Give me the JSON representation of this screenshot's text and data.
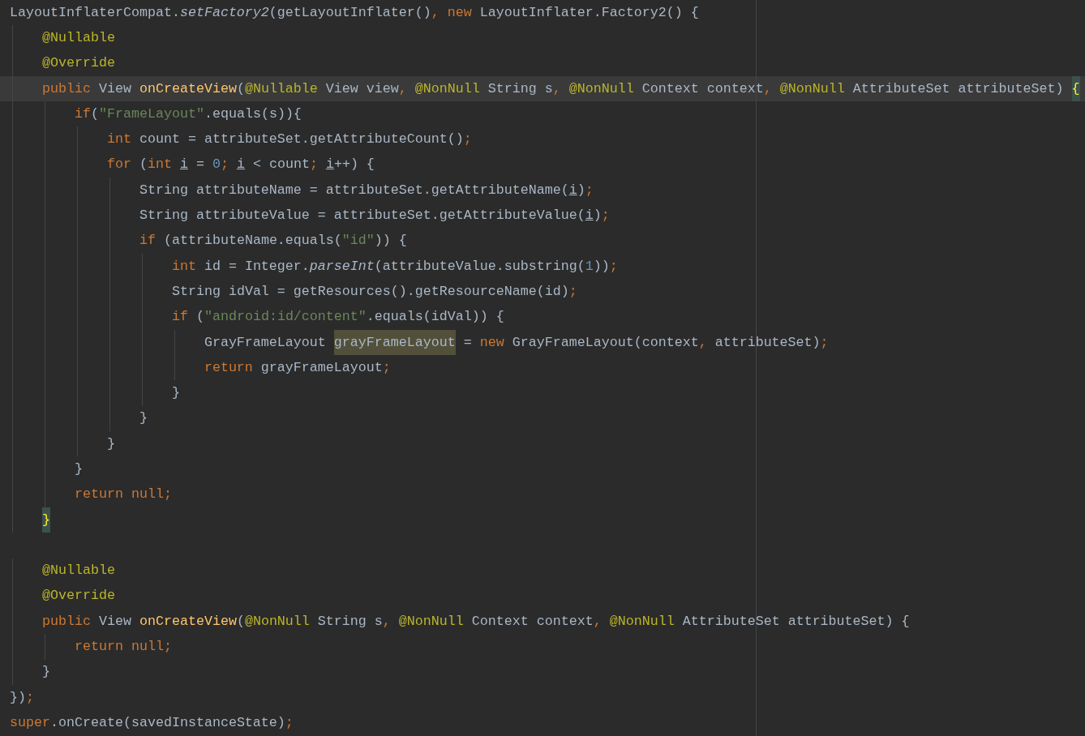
{
  "editor": {
    "lines": [
      {
        "current": false,
        "tokens": [
          {
            "text": "LayoutInflaterCompat.",
            "kind": "plain"
          },
          {
            "text": "setFactory2",
            "kind": "static"
          },
          {
            "text": "(getLayoutInflater()",
            "kind": "plain"
          },
          {
            "text": ", ",
            "kind": "punct"
          },
          {
            "text": "new ",
            "kind": "keyword"
          },
          {
            "text": "LayoutInflater.Factory2() {",
            "kind": "plain"
          }
        ]
      },
      {
        "current": false,
        "tokens": [
          {
            "text": "    @Nullable",
            "kind": "annotation"
          }
        ]
      },
      {
        "current": false,
        "tokens": [
          {
            "text": "    @Override",
            "kind": "annotation"
          }
        ]
      },
      {
        "current": true,
        "tokens": [
          {
            "text": "    public ",
            "kind": "keyword"
          },
          {
            "text": "View ",
            "kind": "plain"
          },
          {
            "text": "onCreateView",
            "kind": "method"
          },
          {
            "text": "(",
            "kind": "plain"
          },
          {
            "text": "@Nullable ",
            "kind": "annotation"
          },
          {
            "text": "View view",
            "kind": "plain"
          },
          {
            "text": ", ",
            "kind": "punct"
          },
          {
            "text": "@NonNull ",
            "kind": "annotation"
          },
          {
            "text": "String s",
            "kind": "plain"
          },
          {
            "text": ", ",
            "kind": "punct"
          },
          {
            "text": "@NonNull ",
            "kind": "annotation"
          },
          {
            "text": "Context context",
            "kind": "plain"
          },
          {
            "text": ", ",
            "kind": "punct"
          },
          {
            "text": "@NonNull ",
            "kind": "annotation"
          },
          {
            "text": "AttributeSet attributeSet) ",
            "kind": "plain"
          },
          {
            "text": "{",
            "kind": "brace-match"
          }
        ]
      },
      {
        "current": false,
        "tokens": [
          {
            "text": "        if",
            "kind": "keyword"
          },
          {
            "text": "(",
            "kind": "plain"
          },
          {
            "text": "\"FrameLayout\"",
            "kind": "string"
          },
          {
            "text": ".equals(s)){",
            "kind": "plain"
          }
        ]
      },
      {
        "current": false,
        "tokens": [
          {
            "text": "            int ",
            "kind": "keyword"
          },
          {
            "text": "count = attributeSet.getAttributeCount()",
            "kind": "plain"
          },
          {
            "text": ";",
            "kind": "punct"
          }
        ]
      },
      {
        "current": false,
        "tokens": [
          {
            "text": "            for ",
            "kind": "keyword"
          },
          {
            "text": "(",
            "kind": "plain"
          },
          {
            "text": "int ",
            "kind": "keyword"
          },
          {
            "text": "i",
            "kind": "reassigned"
          },
          {
            "text": " = ",
            "kind": "plain"
          },
          {
            "text": "0",
            "kind": "number"
          },
          {
            "text": "; ",
            "kind": "punct"
          },
          {
            "text": "i",
            "kind": "reassigned"
          },
          {
            "text": " < count",
            "kind": "plain"
          },
          {
            "text": "; ",
            "kind": "punct"
          },
          {
            "text": "i",
            "kind": "reassigned"
          },
          {
            "text": "++) {",
            "kind": "plain"
          }
        ]
      },
      {
        "current": false,
        "tokens": [
          {
            "text": "                String attributeName = attributeSet.getAttributeName(",
            "kind": "plain"
          },
          {
            "text": "i",
            "kind": "reassigned"
          },
          {
            "text": ")",
            "kind": "plain"
          },
          {
            "text": ";",
            "kind": "punct"
          }
        ]
      },
      {
        "current": false,
        "tokens": [
          {
            "text": "                String attributeValue = attributeSet.getAttributeValue(",
            "kind": "plain"
          },
          {
            "text": "i",
            "kind": "reassigned"
          },
          {
            "text": ")",
            "kind": "plain"
          },
          {
            "text": ";",
            "kind": "punct"
          }
        ]
      },
      {
        "current": false,
        "tokens": [
          {
            "text": "                if ",
            "kind": "keyword"
          },
          {
            "text": "(attributeName.equals(",
            "kind": "plain"
          },
          {
            "text": "\"id\"",
            "kind": "string"
          },
          {
            "text": ")) {",
            "kind": "plain"
          }
        ]
      },
      {
        "current": false,
        "tokens": [
          {
            "text": "                    int ",
            "kind": "keyword"
          },
          {
            "text": "id = Integer.",
            "kind": "plain"
          },
          {
            "text": "parseInt",
            "kind": "static"
          },
          {
            "text": "(attributeValue.substring(",
            "kind": "plain"
          },
          {
            "text": "1",
            "kind": "number"
          },
          {
            "text": "))",
            "kind": "plain"
          },
          {
            "text": ";",
            "kind": "punct"
          }
        ]
      },
      {
        "current": false,
        "tokens": [
          {
            "text": "                    String idVal = getResources().getResourceName(id)",
            "kind": "plain"
          },
          {
            "text": ";",
            "kind": "punct"
          }
        ]
      },
      {
        "current": false,
        "tokens": [
          {
            "text": "                    if ",
            "kind": "keyword"
          },
          {
            "text": "(",
            "kind": "plain"
          },
          {
            "text": "\"android:id/content\"",
            "kind": "string"
          },
          {
            "text": ".equals(idVal)) {",
            "kind": "plain"
          }
        ]
      },
      {
        "current": false,
        "tokens": [
          {
            "text": "                        GrayFrameLayout ",
            "kind": "plain"
          },
          {
            "text": "grayFrameLayout",
            "kind": "occurrence"
          },
          {
            "text": " = ",
            "kind": "plain"
          },
          {
            "text": "new ",
            "kind": "keyword"
          },
          {
            "text": "GrayFrameLayout(context",
            "kind": "plain"
          },
          {
            "text": ", ",
            "kind": "punct"
          },
          {
            "text": "attributeSet)",
            "kind": "plain"
          },
          {
            "text": ";",
            "kind": "punct"
          }
        ]
      },
      {
        "current": false,
        "tokens": [
          {
            "text": "                        return ",
            "kind": "keyword"
          },
          {
            "text": "grayFrameLayout",
            "kind": "plain"
          },
          {
            "text": ";",
            "kind": "punct"
          }
        ]
      },
      {
        "current": false,
        "tokens": [
          {
            "text": "                    }",
            "kind": "plain"
          }
        ]
      },
      {
        "current": false,
        "tokens": [
          {
            "text": "                }",
            "kind": "plain"
          }
        ]
      },
      {
        "current": false,
        "tokens": [
          {
            "text": "            }",
            "kind": "plain"
          }
        ]
      },
      {
        "current": false,
        "tokens": [
          {
            "text": "        }",
            "kind": "plain"
          }
        ]
      },
      {
        "current": false,
        "tokens": [
          {
            "text": "        return null",
            "kind": "keyword"
          },
          {
            "text": ";",
            "kind": "punct"
          }
        ]
      },
      {
        "current": false,
        "tokens": [
          {
            "text": "    }",
            "kind": "brace-match"
          }
        ]
      },
      {
        "current": false
      },
      {
        "current": false,
        "tokens": [
          {
            "text": "    @Nullable",
            "kind": "annotation"
          }
        ]
      },
      {
        "current": false,
        "tokens": [
          {
            "text": "    @Override",
            "kind": "annotation"
          }
        ]
      },
      {
        "current": false,
        "tokens": [
          {
            "text": "    public ",
            "kind": "keyword"
          },
          {
            "text": "View ",
            "kind": "plain"
          },
          {
            "text": "onCreateView",
            "kind": "method"
          },
          {
            "text": "(",
            "kind": "plain"
          },
          {
            "text": "@NonNull ",
            "kind": "annotation"
          },
          {
            "text": "String s",
            "kind": "plain"
          },
          {
            "text": ", ",
            "kind": "punct"
          },
          {
            "text": "@NonNull ",
            "kind": "annotation"
          },
          {
            "text": "Context context",
            "kind": "plain"
          },
          {
            "text": ", ",
            "kind": "punct"
          },
          {
            "text": "@NonNull ",
            "kind": "annotation"
          },
          {
            "text": "AttributeSet attributeSet) {",
            "kind": "plain"
          }
        ]
      },
      {
        "current": false,
        "tokens": [
          {
            "text": "        return null",
            "kind": "keyword"
          },
          {
            "text": ";",
            "kind": "punct"
          }
        ]
      },
      {
        "current": false,
        "tokens": [
          {
            "text": "    }",
            "kind": "plain"
          }
        ]
      },
      {
        "current": false,
        "tokens": [
          {
            "text": "})",
            "kind": "plain"
          },
          {
            "text": ";",
            "kind": "punct"
          }
        ]
      },
      {
        "current": false,
        "tokens": [
          {
            "text": "super",
            "kind": "keyword"
          },
          {
            "text": ".onCreate(savedInstanceState)",
            "kind": "plain"
          },
          {
            "text": ";",
            "kind": "punct"
          }
        ]
      }
    ]
  }
}
